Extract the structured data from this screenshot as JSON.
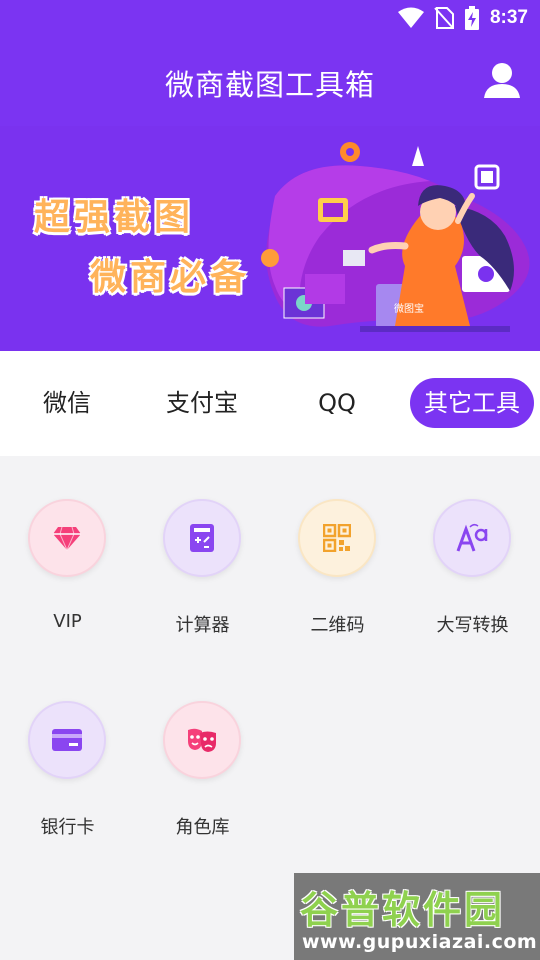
{
  "status_bar": {
    "time": "8:37",
    "icons": [
      "wifi-icon",
      "no-sim-icon",
      "battery-charging-icon"
    ]
  },
  "app_bar": {
    "title": "微商截图工具箱",
    "user_icon": "user-icon"
  },
  "banner": {
    "line1": "超强截图",
    "line2": "微商必备",
    "laptop_text": "微图宝"
  },
  "tabs": [
    {
      "label": "微信",
      "selected": false
    },
    {
      "label": "支付宝",
      "selected": false
    },
    {
      "label": "QQ",
      "selected": false
    },
    {
      "label": "其它工具",
      "selected": true
    }
  ],
  "tools": [
    {
      "label": "VIP",
      "icon": "diamond-icon"
    },
    {
      "label": "计算器",
      "icon": "calculator-icon"
    },
    {
      "label": "二维码",
      "icon": "qr-code-icon"
    },
    {
      "label": "大写转换",
      "icon": "text-case-icon"
    },
    {
      "label": "银行卡",
      "icon": "bank-card-icon"
    },
    {
      "label": "角色库",
      "icon": "masks-icon"
    }
  ],
  "watermark": {
    "title": "谷普软件园",
    "url": "www.gupuxiazai.com"
  },
  "colors": {
    "primary": "#7b34f2",
    "banner_text": "#ffb35a"
  }
}
